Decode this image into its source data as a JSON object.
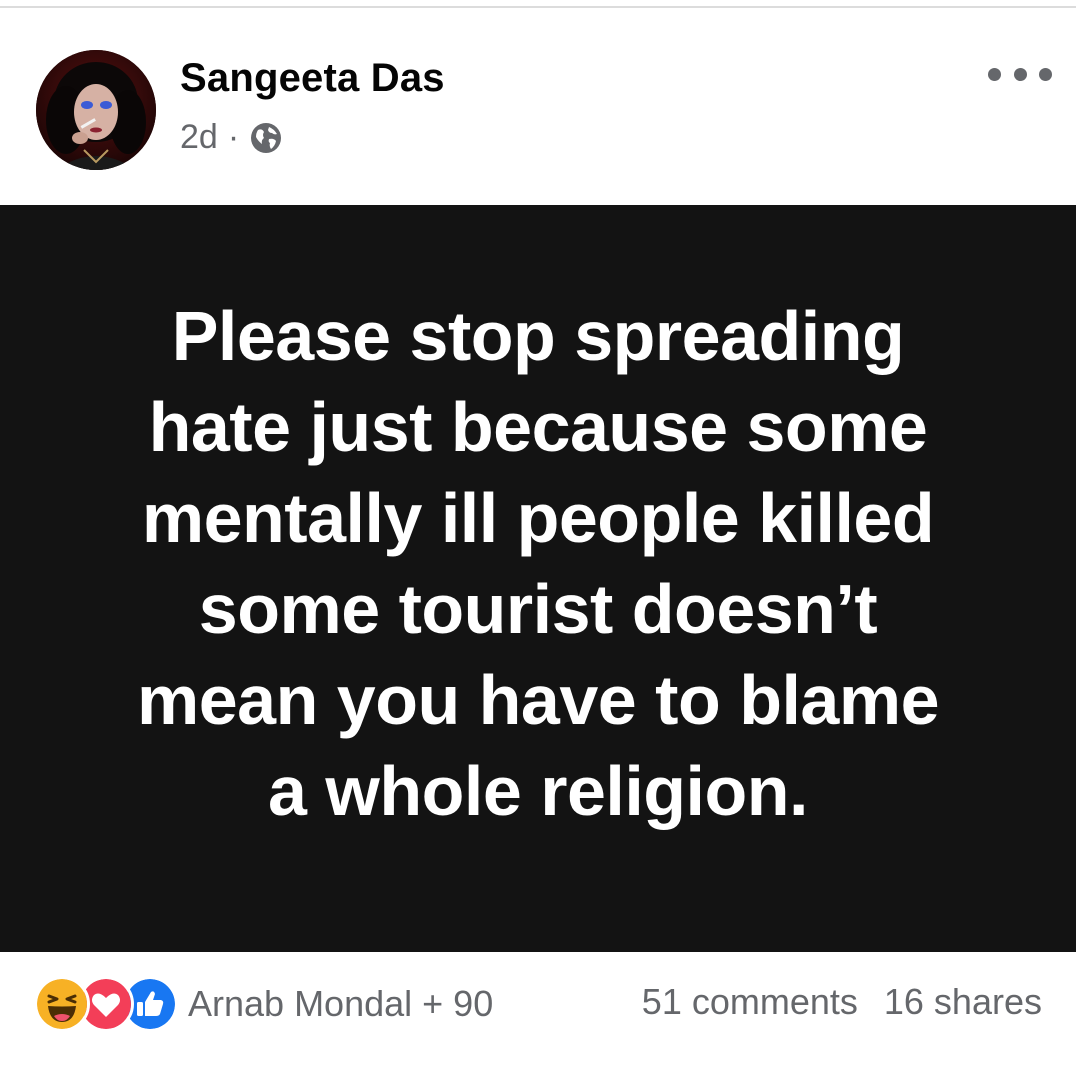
{
  "post": {
    "author": "Sangeeta Das",
    "time": "2d",
    "separator": "·",
    "audience_icon": "globe-icon",
    "menu_icon": "more-horizontal-icon",
    "text_lines": [
      "Please stop spreading",
      "hate just because some",
      "mentally ill people killed",
      "some tourist doesn’t",
      "mean you have to blame",
      "a whole religion."
    ],
    "image_background": "#131313"
  },
  "footer": {
    "reaction_icons": [
      "haha-icon",
      "love-icon",
      "like-icon"
    ],
    "reactors_text": "Arnab Mondal + 90",
    "comments": "51 comments",
    "shares": "16 shares"
  },
  "colors": {
    "text_primary": "#050505",
    "text_secondary": "#65676b",
    "like_blue": "#1877f2",
    "love_red": "#f33e58",
    "haha_yellow": "#f7b125"
  }
}
